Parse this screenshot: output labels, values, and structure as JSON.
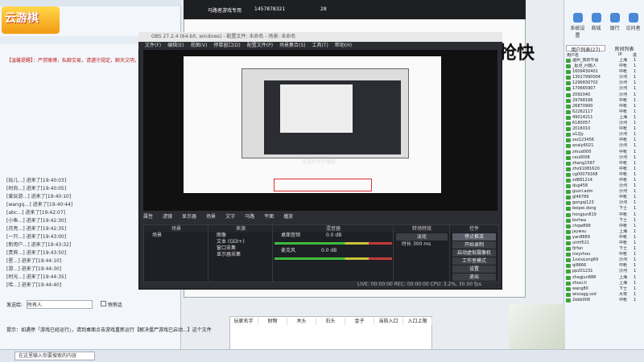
{
  "chat": {
    "logo": "云游棋",
    "notice": "【温馨提醒】：严禁赌博，私聊交易，请遵守规定，聊天文明，广告，严禁违法信息",
    "messages": [
      "[玩儿…] 进来了[19:40:03]",
      "[时尚…] 进来了[19:40:05]",
      "[爱玩游…] 进来了[19:40:10]",
      "[wangq…] 进来了[19:40:44]",
      "[abc…] 进来了[19:42:07]",
      "[小鱼…] 进来了[19:42:30]",
      "[月亮…] 进来了[19:42:35]",
      "[一只…] 进来了[19:43:00]",
      "[新用户…] 进来了[19:43:32]",
      "[贵宾…] 进来了[19:43:50]",
      "[星…] 进来了[19:44:10]",
      "[游…] 进来了[19:44:30]",
      "[时光…] 进来了[19:44:35]",
      "[哈…] 进来了[19:44:40]"
    ],
    "send_to_label": "发送给:",
    "send_to_value": "所有人",
    "checkbox_label": "悄悄话",
    "bottom_tip": "提示：如遇停「游戏已经运行」，请到桌面点击游戏重新运行【解决僵尸游戏已启动...】这个文件",
    "search_placeholder": "在这里输入你要搜索的内容"
  },
  "live": {
    "title": "马路者游戏专用",
    "id": "1457878321",
    "stat": "28",
    "big_text": "抢快"
  },
  "obs": {
    "title": "OBS 27.2.4 (64-bit, windows) - 配置文件: 未命名 - 场景: 未命名",
    "menu": [
      "文件(F)",
      "编辑(E)",
      "视图(V)",
      "停靠窗口(D)",
      "配置文件(P)",
      "场景集合(S)",
      "工具(T)",
      "帮助(H)"
    ],
    "preview_overlay_text": "欢迎平台开播啦",
    "scene_bar": [
      "属性",
      "滤镜",
      "显示器",
      "场景",
      "文字",
      "马路",
      "平面",
      "播放"
    ],
    "docks": {
      "scenes": {
        "header": "场景",
        "items": [
          "场景"
        ]
      },
      "sources": {
        "header": "来源",
        "items": [
          "图像",
          "文本 (GDI+)",
          "窗口采集",
          "显示器采集"
        ]
      },
      "mixer": {
        "header": "混音器",
        "tracks": [
          "桌面音频",
          "麦克风"
        ],
        "db": [
          "0.0 dB",
          "0.0 dB"
        ]
      },
      "transitions": {
        "header": "转场特效",
        "type": "淡化",
        "duration_label": "时长",
        "duration": "300 ms"
      },
      "controls": {
        "header": "控件",
        "buttons": [
          "停止推流",
          "开始录制",
          "启动虚拟摄像机",
          "工作室模式",
          "设置",
          "退出"
        ]
      }
    },
    "status": "LIVE: 00:00:00   REC: 00:00:00   CPU: 3.2%, 30.00 fps"
  },
  "right_panel": {
    "buttons": [
      "系统设置",
      "商城",
      "银行",
      "访问者"
    ],
    "tabs": [
      "用户列表(27)",
      "房间列表"
    ],
    "col_headers": [
      "用户名",
      "IP",
      "进"
    ],
    "users": [
      [
        "温州_真的牛逼",
        "上海",
        "1"
      ],
      [
        "_起点_问题人",
        "中枪",
        "1"
      ],
      [
        "1609430401",
        "中枪",
        "1"
      ],
      [
        "13017990004",
        "沙河",
        "1"
      ],
      [
        "1296830702",
        "沙河",
        "1"
      ],
      [
        "170665907",
        "沙河",
        "1"
      ],
      [
        "2092040",
        "沙河",
        "1"
      ],
      [
        "29768166",
        "中枪",
        "1"
      ],
      [
        "26870900",
        "中枪",
        "1"
      ],
      [
        "62262117",
        "中枪",
        "1"
      ],
      [
        "49014211",
        "上海",
        "1"
      ],
      [
        "6180057",
        "沙河",
        "1"
      ],
      [
        "2016010",
        "中枪",
        "1"
      ],
      [
        "a12Jy",
        "沙河",
        "1"
      ],
      [
        "zsz123456",
        "中枪",
        "1"
      ],
      [
        "analy6021",
        "沙河",
        "1"
      ],
      [
        "zmud000",
        "中枪",
        "1"
      ],
      [
        "ceu0008",
        "沙河",
        "1"
      ],
      [
        "zhang1587",
        "中枪",
        "1"
      ],
      [
        "zhs91081620",
        "中枪",
        "1"
      ],
      [
        "cg00079168",
        "中枪",
        "1"
      ],
      [
        "zd881214",
        "中枪",
        "1"
      ],
      [
        "dug458",
        "沙河",
        "1"
      ],
      [
        "guori.adm",
        "沙河",
        "1"
      ],
      [
        "gl46789",
        "中枪",
        "1"
      ],
      [
        "gongqi123",
        "沙河",
        "1"
      ],
      [
        "beipei.dong",
        "下士",
        "1"
      ],
      [
        "hongjun819",
        "中枪",
        "1"
      ],
      [
        "bsrhea",
        "下士",
        "1"
      ],
      [
        "chqw899",
        "中枪",
        "1"
      ],
      [
        "jaywsu",
        "上海",
        "1"
      ],
      [
        "yan8889",
        "中枪",
        "1"
      ],
      [
        "uirhf521",
        "中枪",
        "1"
      ],
      [
        "fjrfan",
        "下士",
        "1"
      ],
      [
        "iceyzhou",
        "中枪",
        "1"
      ],
      [
        "1xxiuLong69",
        "沙河",
        "1"
      ],
      [
        "qi8666",
        "中枪",
        "1"
      ],
      [
        "pp201231",
        "沙河",
        "1"
      ],
      [
        "zhagjun888",
        "上海",
        "1"
      ],
      [
        "zhosi.ti",
        "上海",
        "1"
      ],
      [
        "wang80",
        "下士",
        "1"
      ],
      [
        "wisssgg.ssd",
        "大将",
        "1"
      ],
      [
        "2ebb006",
        "中枪",
        "1"
      ]
    ]
  },
  "table_window": {
    "headers": [
      "玩家名字",
      "财物",
      "木头",
      "石头",
      "金子",
      "当前入口",
      "入口上限"
    ]
  }
}
